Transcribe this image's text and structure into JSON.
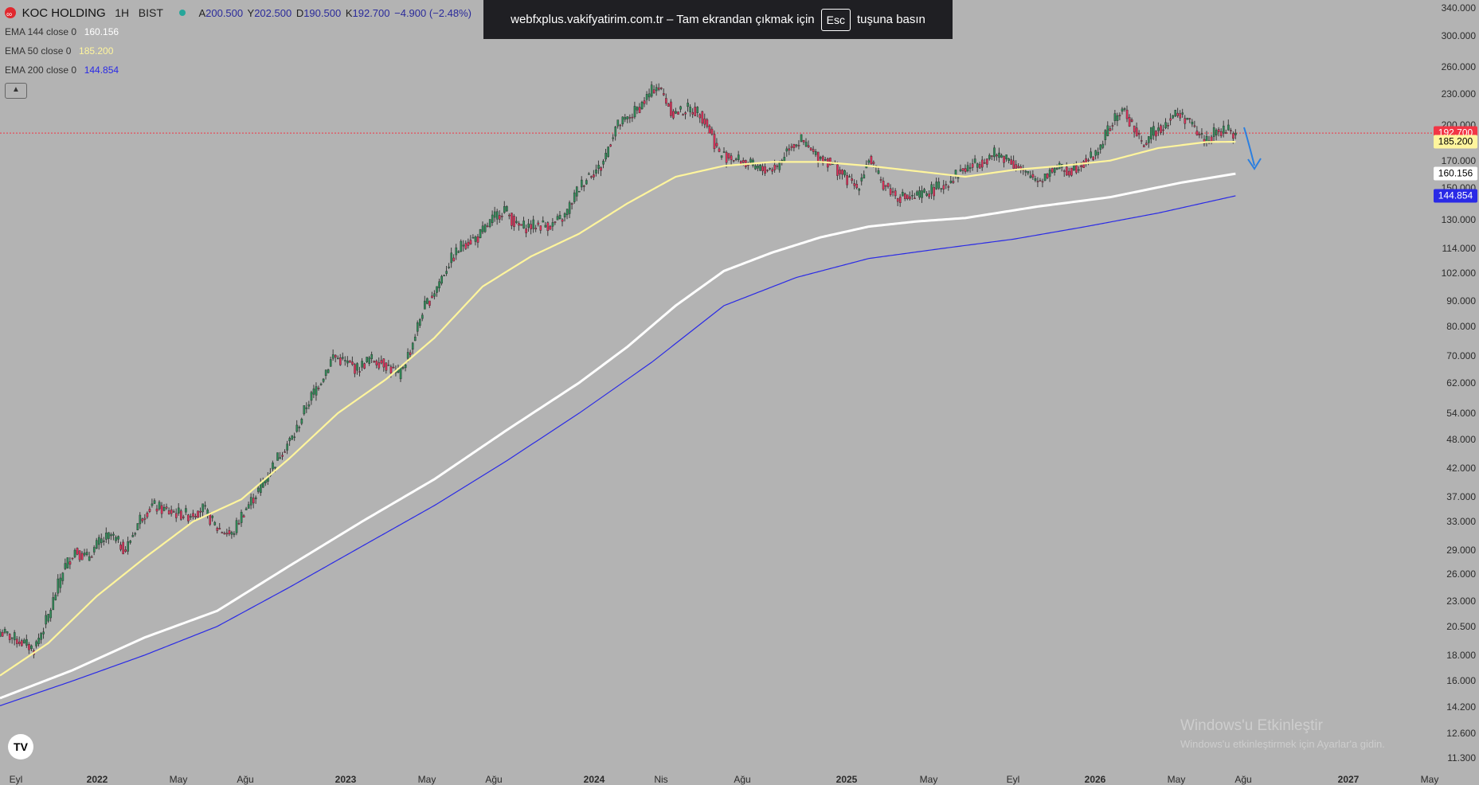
{
  "header": {
    "symbol": "KOC HOLDING",
    "interval": "1H",
    "exchange": "BIST",
    "ohlc": {
      "open_label": "A",
      "open": "200.500",
      "high_label": "Y",
      "high": "202.500",
      "low_label": "D",
      "low": "190.500",
      "close_label": "K",
      "close": "192.700",
      "change": "−4.900 (−2.48%)"
    }
  },
  "indicators": [
    {
      "label": "EMA 144 close 0",
      "value": "160.156",
      "color": "#ffffff"
    },
    {
      "label": "EMA 50 close 0",
      "value": "185.200",
      "color": "#fff59d"
    },
    {
      "label": "EMA 200 close 0",
      "value": "144.854",
      "color": "#2a2ae6"
    }
  ],
  "banner": {
    "text_before": "webfxplus.vakifyatirim.com.tr – Tam ekrandan çıkmak için",
    "key": "Esc",
    "text_after": "tuşuna basın"
  },
  "price_tags": [
    {
      "value": "192.700",
      "bg": "#f23645",
      "fg": "#ffffff"
    },
    {
      "value": "185.200",
      "bg": "#fff59d",
      "fg": "#000000"
    },
    {
      "value": "160.156",
      "bg": "#ffffff",
      "fg": "#000000"
    },
    {
      "value": "144.854",
      "bg": "#2a2ae6",
      "fg": "#ffffff"
    }
  ],
  "watermark": {
    "title": "Windows'u Etkinleştir",
    "subtitle": "Windows'u etkinleştirmek için Ayarlar'a gidin."
  },
  "logo": "TV",
  "chart_data": {
    "type": "candlestick",
    "y_scale": "log",
    "ylim": [
      11.0,
      345.0
    ],
    "y_ticks": [
      "340.000",
      "300.000",
      "260.000",
      "230.000",
      "200.000",
      "170.000",
      "150.000",
      "130.000",
      "114.000",
      "102.000",
      "90.000",
      "80.000",
      "70.000",
      "62.000",
      "54.000",
      "48.000",
      "42.000",
      "37.000",
      "33.000",
      "29.000",
      "26.000",
      "23.000",
      "20.500",
      "18.000",
      "16.000",
      "14.200",
      "12.600",
      "11.300"
    ],
    "x_ticks": [
      {
        "label": "Eyl",
        "year": false
      },
      {
        "label": "2022",
        "year": true
      },
      {
        "label": "May",
        "year": false
      },
      {
        "label": "Ağu",
        "year": false
      },
      {
        "label": "2023",
        "year": true
      },
      {
        "label": "May",
        "year": false
      },
      {
        "label": "Ağu",
        "year": false
      },
      {
        "label": "2024",
        "year": true
      },
      {
        "label": "Nis",
        "year": false
      },
      {
        "label": "Ağu",
        "year": false
      },
      {
        "label": "2025",
        "year": true
      },
      {
        "label": "May",
        "year": false
      },
      {
        "label": "Eyl",
        "year": false
      },
      {
        "label": "2026",
        "year": true
      },
      {
        "label": "May",
        "year": false
      },
      {
        "label": "Ağu",
        "year": false
      },
      {
        "label": "2027",
        "year": true
      },
      {
        "label": "May",
        "year": false
      }
    ],
    "last_price": 192.7,
    "price_path": [
      [
        0,
        20.0
      ],
      [
        8,
        19.2
      ],
      [
        14,
        18.5
      ],
      [
        20,
        21.5
      ],
      [
        26,
        26.5
      ],
      [
        31,
        29.0
      ],
      [
        36,
        28.0
      ],
      [
        41,
        30.0
      ],
      [
        46,
        31.0
      ],
      [
        52,
        29.0
      ],
      [
        58,
        33.5
      ],
      [
        63,
        35.5
      ],
      [
        70,
        34.5
      ],
      [
        78,
        34.0
      ],
      [
        84,
        35.0
      ],
      [
        90,
        32.0
      ],
      [
        96,
        31.0
      ],
      [
        100,
        34.0
      ],
      [
        107,
        38.0
      ],
      [
        116,
        45.0
      ],
      [
        122,
        49.0
      ],
      [
        127,
        56.0
      ],
      [
        133,
        63.0
      ],
      [
        138,
        70.0
      ],
      [
        143,
        68.0
      ],
      [
        148,
        66.0
      ],
      [
        153,
        69.0
      ],
      [
        159,
        68.0
      ],
      [
        165,
        64.0
      ],
      [
        170,
        72.0
      ],
      [
        175,
        86.0
      ],
      [
        180,
        94.0
      ],
      [
        186,
        107.0
      ],
      [
        192,
        117.0
      ],
      [
        198,
        120.0
      ],
      [
        204,
        130.0
      ],
      [
        209,
        137.0
      ],
      [
        214,
        126.0
      ],
      [
        218,
        126.0
      ],
      [
        224,
        127.0
      ],
      [
        229,
        127.0
      ],
      [
        234,
        132.0
      ],
      [
        239,
        148.0
      ],
      [
        244,
        160.0
      ],
      [
        249,
        165.0
      ],
      [
        255,
        198.0
      ],
      [
        260,
        205.0
      ],
      [
        266,
        220.0
      ],
      [
        272,
        240.0
      ],
      [
        275,
        228.0
      ],
      [
        279,
        210.0
      ],
      [
        285,
        215.0
      ],
      [
        290,
        212.0
      ],
      [
        294,
        195.0
      ],
      [
        298,
        175.0
      ],
      [
        304,
        172.0
      ],
      [
        310,
        167.0
      ],
      [
        316,
        163.0
      ],
      [
        322,
        165.0
      ],
      [
        327,
        182.0
      ],
      [
        332,
        186.0
      ],
      [
        337,
        175.0
      ],
      [
        343,
        170.0
      ],
      [
        350,
        158.0
      ],
      [
        355,
        150.0
      ],
      [
        360,
        172.0
      ],
      [
        365,
        155.0
      ],
      [
        371,
        145.0
      ],
      [
        378,
        143.0
      ],
      [
        385,
        148.0
      ],
      [
        391,
        152.0
      ],
      [
        398,
        162.0
      ],
      [
        405,
        168.0
      ],
      [
        412,
        175.0
      ],
      [
        418,
        172.0
      ],
      [
        424,
        160.0
      ],
      [
        431,
        156.0
      ],
      [
        437,
        165.0
      ],
      [
        443,
        162.0
      ],
      [
        448,
        168.0
      ],
      [
        454,
        175.0
      ],
      [
        459,
        195.0
      ],
      [
        465,
        215.0
      ],
      [
        469,
        200.0
      ],
      [
        473,
        182.0
      ],
      [
        477,
        192.0
      ],
      [
        482,
        200.0
      ],
      [
        487,
        210.0
      ],
      [
        492,
        206.0
      ],
      [
        495,
        195.0
      ],
      [
        499,
        187.0
      ],
      [
        504,
        193.0
      ],
      [
        509,
        195.0
      ],
      [
        512,
        192.7
      ]
    ],
    "series": [
      {
        "name": "EMA 50 close 0",
        "color": "#fff59d",
        "points": [
          [
            0,
            16.4
          ],
          [
            20,
            19.0
          ],
          [
            40,
            23.5
          ],
          [
            60,
            28.0
          ],
          [
            80,
            33.0
          ],
          [
            100,
            36.5
          ],
          [
            120,
            44.0
          ],
          [
            140,
            54.0
          ],
          [
            160,
            63.0
          ],
          [
            180,
            76.0
          ],
          [
            200,
            96.0
          ],
          [
            220,
            110.0
          ],
          [
            240,
            122.0
          ],
          [
            260,
            140.0
          ],
          [
            280,
            158.0
          ],
          [
            300,
            166.0
          ],
          [
            320,
            169.0
          ],
          [
            340,
            169.0
          ],
          [
            360,
            166.0
          ],
          [
            380,
            162.0
          ],
          [
            400,
            158.0
          ],
          [
            420,
            163.0
          ],
          [
            440,
            166.0
          ],
          [
            460,
            170.0
          ],
          [
            480,
            180.0
          ],
          [
            500,
            185.0
          ],
          [
            512,
            185.2
          ]
        ]
      },
      {
        "name": "EMA 144 close 0",
        "color": "#ffffff",
        "points": [
          [
            0,
            14.8
          ],
          [
            30,
            16.8
          ],
          [
            60,
            19.5
          ],
          [
            90,
            22.0
          ],
          [
            120,
            27.0
          ],
          [
            150,
            33.0
          ],
          [
            180,
            40.0
          ],
          [
            210,
            50.0
          ],
          [
            240,
            62.0
          ],
          [
            260,
            73.0
          ],
          [
            280,
            88.0
          ],
          [
            300,
            103.0
          ],
          [
            320,
            112.0
          ],
          [
            340,
            120.0
          ],
          [
            360,
            126.0
          ],
          [
            380,
            129.0
          ],
          [
            400,
            131.0
          ],
          [
            430,
            138.0
          ],
          [
            460,
            144.0
          ],
          [
            490,
            154.0
          ],
          [
            512,
            160.2
          ]
        ]
      },
      {
        "name": "EMA 200 close 0",
        "color": "#2a2ae6",
        "points": [
          [
            0,
            14.3
          ],
          [
            30,
            16.0
          ],
          [
            60,
            18.0
          ],
          [
            90,
            20.5
          ],
          [
            120,
            24.5
          ],
          [
            150,
            29.5
          ],
          [
            180,
            35.5
          ],
          [
            210,
            43.5
          ],
          [
            240,
            54.0
          ],
          [
            270,
            68.0
          ],
          [
            300,
            88.0
          ],
          [
            330,
            100.0
          ],
          [
            360,
            109.0
          ],
          [
            390,
            114.0
          ],
          [
            420,
            119.0
          ],
          [
            450,
            126.0
          ],
          [
            480,
            134.0
          ],
          [
            512,
            144.9
          ]
        ]
      }
    ],
    "annotation": {
      "type": "arrow",
      "direction": "down",
      "color": "#2b7fe0"
    }
  }
}
